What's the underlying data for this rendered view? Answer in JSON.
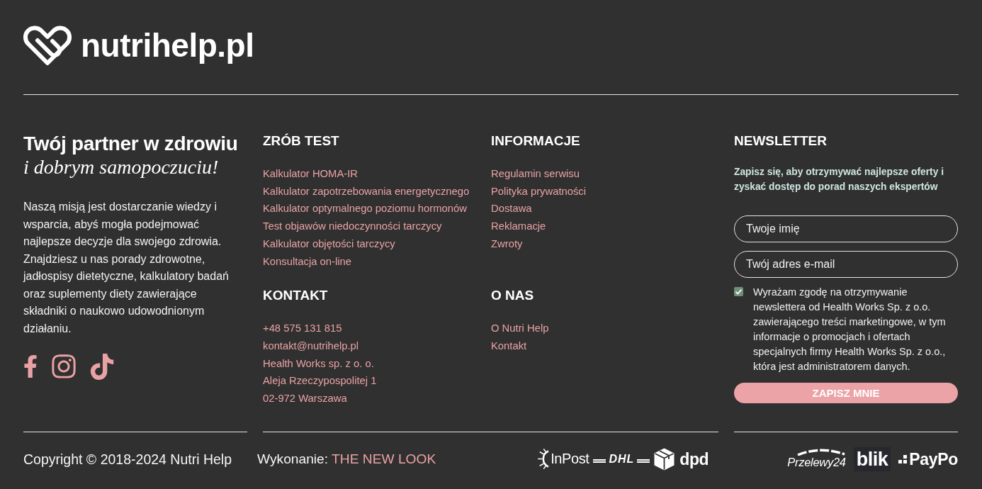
{
  "brand": {
    "name": "nutrihelp.pl"
  },
  "about": {
    "title": "Twój partner w zdrowiu",
    "tagline": "i dobrym samopoczuciu!",
    "text": "Naszą misją jest dostarczanie wiedzy i wsparcia, abyś mogła podejmować najlepsze decyzje dla swojego zdrowia. Znajdziesz u nas porady zdrowotne, jadłospisy dietetyczne, kalkulatory badań oraz suplementy diety zawierające składniki o naukowo udowodnionym działaniu.",
    "social": [
      {
        "kind": "facebook"
      },
      {
        "kind": "instagram"
      },
      {
        "kind": "tiktok"
      }
    ]
  },
  "link_groups": [
    {
      "title": "ZRÓB TEST",
      "links": [
        "Kalkulator HOMA-IR",
        "Kalkulator zapotrzebowania energetycznego",
        "Kalkulator optymalnego poziomu hormonów",
        "Test objawów niedoczynności tarczycy",
        "Kalkulator objętości tarczycy",
        "Konsultacja on-line"
      ]
    },
    {
      "title": "KONTAKT",
      "links": [
        "+48 575 131 815",
        "kontakt@nutrihelp.pl",
        "Health Works sp. z o. o.",
        "Aleja Rzeczypospolitej 1",
        "02-972 Warszawa"
      ]
    },
    {
      "title": "INFORMACJE",
      "links": [
        "Regulamin serwisu",
        "Polityka prywatności",
        "Dostawa",
        "Reklamacje",
        "Zwroty"
      ]
    },
    {
      "title": "O NAS",
      "links": [
        "O Nutri Help",
        "Kontakt"
      ]
    }
  ],
  "newsletter": {
    "title": "NEWSLETTER",
    "intro": "Zapisz się, aby otrzymywać najlepsze oferty i zyskać dostęp do porad naszych ekspertów",
    "fields": [
      {
        "placeholder": "Twoje imię"
      },
      {
        "placeholder": "Twój adres e-mail"
      }
    ],
    "consent": {
      "checked": true,
      "text": "Wyrażam zgodę na otrzymywanie newslettera od Health Works Sp. z o.o. zawierającego treści marketingowe, w tym informacje o promocjach i ofertach specjalnych firmy Health Works Sp. z o.o., która jest administratorem danych."
    },
    "button": "ZAPISZ MNIE"
  },
  "bottom_bar": {
    "copyright": "Copyright © 2018-2024 Nutri Help",
    "credit_label": "Wykonanie:",
    "credit_link": "THE NEW LOOK",
    "shipping_logos": [
      {
        "kind": "inpost",
        "text": "InPost"
      },
      {
        "kind": "dhl",
        "text": "DHL"
      },
      {
        "kind": "dpd",
        "text": "dpd"
      }
    ],
    "payment_logos": [
      {
        "kind": "przelewy24",
        "text": "Przelewy24"
      },
      {
        "kind": "blik",
        "text": "blik"
      },
      {
        "kind": "paypo",
        "text": "PayPo"
      }
    ]
  }
}
